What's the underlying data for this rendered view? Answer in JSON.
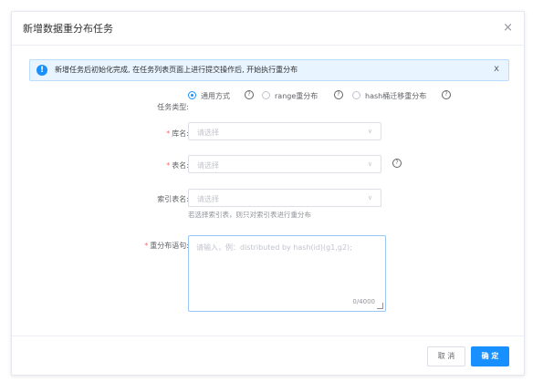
{
  "dialog": {
    "title": "新增数据重分布任务",
    "close_label": "×"
  },
  "alert": {
    "icon": "info-icon",
    "icon_glyph": "!",
    "text": "新增任务后初始化完成, 在任务列表页面上进行提交操作后, 开始执行重分布",
    "close_label": "x"
  },
  "form": {
    "task_type": {
      "label": "任务类型:",
      "options": [
        {
          "label": "通用方式",
          "checked": true
        },
        {
          "label": "range重分布",
          "checked": false
        },
        {
          "label": "hash桶迁移重分布",
          "checked": false
        }
      ],
      "help_glyph": "?"
    },
    "database": {
      "required_mark": "*",
      "label": "库名:",
      "placeholder": "请选择"
    },
    "table": {
      "required_mark": "*",
      "label": "表名:",
      "placeholder": "请选择"
    },
    "index_table": {
      "label": "索引表名:",
      "placeholder": "请选择",
      "hint": "若选择索引表，则只对索引表进行重分布"
    },
    "statement": {
      "required_mark": "*",
      "label": "重分布语句:",
      "placeholder": "请输入，例：distributed by hash(id)(g1,g2);",
      "counter": "0/4000"
    }
  },
  "footer": {
    "cancel_label": "取 消",
    "ok_label": "确 定"
  },
  "colors": {
    "primary": "#1890ff",
    "required": "#f56c6c",
    "alert_bg": "#e8f4ff"
  }
}
